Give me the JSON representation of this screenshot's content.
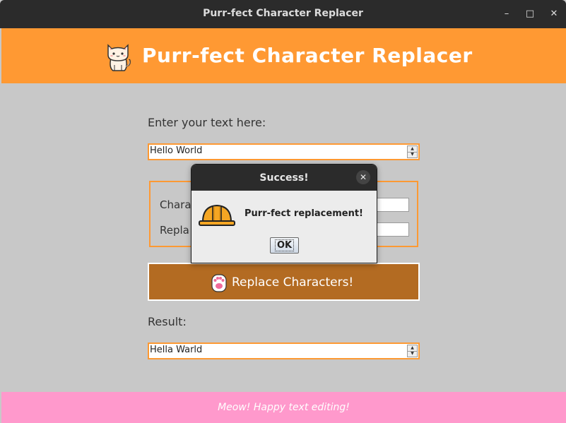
{
  "window": {
    "title": "Purr-fect Character Replacer",
    "minimize_icon": "minimize-icon",
    "maximize_icon": "maximize-icon",
    "close_icon": "close-icon"
  },
  "header": {
    "title": "Purr-fect Character Replacer",
    "icon": "cat-icon",
    "background": "#ff9933"
  },
  "form": {
    "input_label": "Enter your text here:",
    "input_value": "Hello World",
    "char_to_replace_label": "Chara",
    "replace_with_label": "Repla",
    "replace_button_label": "Replace Characters!",
    "replace_button_icon": "paw-icon",
    "result_label": "Result:",
    "result_value": "Hella Warld"
  },
  "footer": {
    "text": "Meow! Happy text editing!",
    "background": "#ff99cc"
  },
  "dialog": {
    "title": "Success!",
    "message": "Purr-fect replacement!",
    "icon": "hard-hat-icon",
    "ok_label": "OK",
    "close_icon": "close-icon"
  },
  "colors": {
    "accent": "#ff9933",
    "button": "#b36b22",
    "panel": "#c8c8c8"
  }
}
